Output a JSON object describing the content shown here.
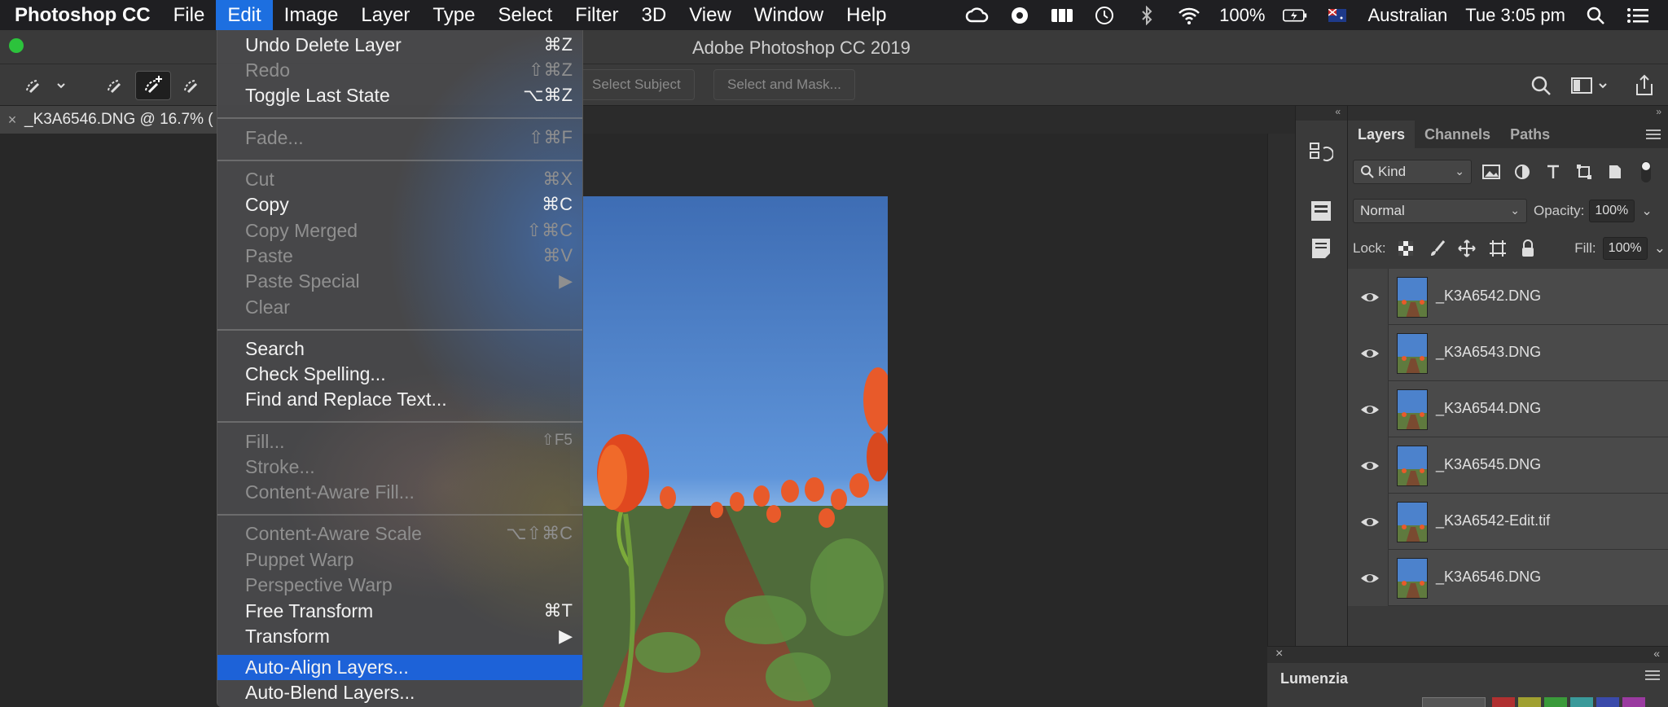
{
  "menubar": {
    "app_name": "Photoshop CC",
    "menus": [
      "File",
      "Edit",
      "Image",
      "Layer",
      "Type",
      "Select",
      "Filter",
      "3D",
      "View",
      "Window",
      "Help"
    ],
    "battery": "100%",
    "input_source": "Australian",
    "clock": "Tue 3:05 pm"
  },
  "window": {
    "title": "Adobe Photoshop CC 2019"
  },
  "options_bar": {
    "select_subject": "Select Subject",
    "select_and_mask": "Select and Mask..."
  },
  "document_tab": {
    "title": "_K3A6546.DNG @ 16.7% (",
    "close": "×"
  },
  "edit_menu": {
    "items": [
      {
        "label": "Undo Delete Layer",
        "shortcut": "⌘Z"
      },
      {
        "label": "Redo",
        "shortcut": "⇧⌘Z"
      },
      {
        "label": "Toggle Last State",
        "shortcut": "⌥⌘Z"
      },
      {
        "label": "Fade...",
        "shortcut": "⇧⌘F"
      },
      {
        "label": "Cut",
        "shortcut": "⌘X"
      },
      {
        "label": "Copy",
        "shortcut": "⌘C"
      },
      {
        "label": "Copy Merged",
        "shortcut": "⇧⌘C"
      },
      {
        "label": "Paste",
        "shortcut": "⌘V"
      },
      {
        "label": "Paste Special",
        "shortcut": "▶"
      },
      {
        "label": "Clear",
        "shortcut": ""
      },
      {
        "label": "Search",
        "shortcut": ""
      },
      {
        "label": "Check Spelling...",
        "shortcut": ""
      },
      {
        "label": "Find and Replace Text...",
        "shortcut": ""
      },
      {
        "label": "Fill...",
        "shortcut": "⇧F5"
      },
      {
        "label": "Stroke...",
        "shortcut": ""
      },
      {
        "label": "Content-Aware Fill...",
        "shortcut": ""
      },
      {
        "label": "Content-Aware Scale",
        "shortcut": "⌥⇧⌘C"
      },
      {
        "label": "Puppet Warp",
        "shortcut": ""
      },
      {
        "label": "Perspective Warp",
        "shortcut": ""
      },
      {
        "label": "Free Transform",
        "shortcut": "⌘T"
      },
      {
        "label": "Transform",
        "shortcut": "▶"
      },
      {
        "label": "Auto-Align Layers...",
        "shortcut": ""
      },
      {
        "label": "Auto-Blend Layers...",
        "shortcut": ""
      }
    ]
  },
  "layers_panel": {
    "tabs": [
      "Layers",
      "Channels",
      "Paths"
    ],
    "filter_kind": "Kind",
    "blend_mode": "Normal",
    "opacity_label": "Opacity:",
    "opacity_value": "100%",
    "lock_label": "Lock:",
    "fill_label": "Fill:",
    "fill_value": "100%",
    "layers": [
      "_K3A6542.DNG",
      "_K3A6543.DNG",
      "_K3A6544.DNG",
      "_K3A6545.DNG",
      "_K3A6542-Edit.tif",
      "_K3A6546.DNG"
    ]
  },
  "lumenzia_panel": {
    "title": "Lumenzia",
    "close": "×"
  },
  "colors": {
    "menu_highlight": "#1d62d8",
    "menubar_active": "#1d6fe0",
    "traffic_green": "#2cc33c",
    "panel_bg": "#3a3a3a"
  }
}
